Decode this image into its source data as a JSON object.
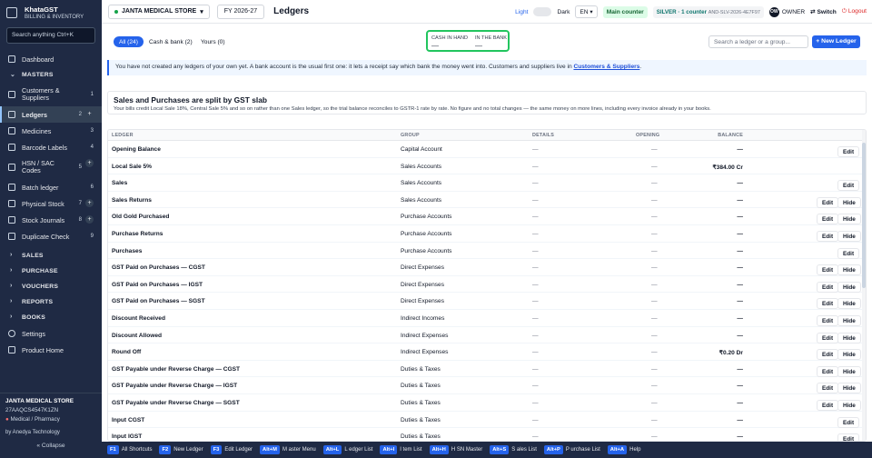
{
  "app": {
    "name": "KhataGST",
    "tagline": "BILLING & INVENTORY"
  },
  "sidebar": {
    "search_placeholder": "Search anything  Ctrl+K",
    "items": [
      {
        "id": "dashboard",
        "label": "Dashboard",
        "icon": "dashboard-icon"
      },
      {
        "id": "customers-suppliers",
        "label": "Customers & Suppliers",
        "count": "1",
        "icon": "users-icon"
      },
      {
        "id": "ledgers",
        "label": "Ledgers",
        "count": "2",
        "icon": "book-icon",
        "active": true
      },
      {
        "id": "medicines",
        "label": "Medicines",
        "count": "3",
        "icon": "pill-icon"
      },
      {
        "id": "barcode-labels",
        "label": "Barcode Labels",
        "count": "4",
        "icon": "barcode-icon"
      },
      {
        "id": "hsn-sac",
        "label": "HSN / SAC Codes",
        "count": "5",
        "icon": "tag-icon"
      },
      {
        "id": "batch-ledger",
        "label": "Batch ledger",
        "count": "6",
        "icon": "batch-icon"
      },
      {
        "id": "physical-stock",
        "label": "Physical Stock",
        "count": "7",
        "icon": "box-icon"
      },
      {
        "id": "stock-journals",
        "label": "Stock Journals",
        "count": "8",
        "icon": "journal-icon"
      },
      {
        "id": "duplicate-check",
        "label": "Duplicate Check",
        "count": "9",
        "icon": "copy-icon"
      }
    ],
    "sections": {
      "masters": "MASTERS",
      "sales": "SALES",
      "purchase": "PURCHASE",
      "vouchers": "VOUCHERS",
      "reports": "REPORTS",
      "books": "BOOKS"
    },
    "settings": "Settings",
    "product_home": "Product Home",
    "company": "JANTA MEDICAL STORE",
    "gstin": "27AAQCS4547K1ZN",
    "business_type": "Medical / Pharmacy",
    "by": "by Anedya Technology",
    "collapse": "« Collapse"
  },
  "topbar": {
    "company": "JANTA MEDICAL STORE",
    "fy": "FY 2026-27",
    "title": "Ledgers",
    "theme_light": "Light",
    "theme_dark": "Dark",
    "lang": "EN",
    "counter": "Main counter",
    "plan": "SILVER · 1 counter",
    "plan_code": "AND-SLV-2026-4E7F97",
    "avatar": "OW",
    "role": "OWNER",
    "switch": "Switch",
    "logout": "Logout"
  },
  "filters": {
    "tabs": [
      {
        "label": "All (24)",
        "active": true
      },
      {
        "label": "Cash & bank (2)",
        "active": false
      },
      {
        "label": "Yours (0)",
        "active": false
      }
    ],
    "cash_label": "CASH IN HAND",
    "cash_value": "—",
    "bank_label": "IN THE BANK",
    "bank_value": "—",
    "search_placeholder": "Search a ledger or a group...",
    "new_ledger": "+ New Ledger"
  },
  "info": {
    "text": "You have not created any ledgers of your own yet. A bank account is the usual first one: it lets a receipt say which bank the money went into. Customers and suppliers live in ",
    "link": "Customers & Suppliers",
    "end": "."
  },
  "gst_card": {
    "title": "Sales and Purchases are split by GST slab",
    "desc": "Your bills credit Local Sale 18%, Central Sale 5% and so on rather than one Sales ledger, so the trial balance reconciles to GSTR-1 rate by rate. No figure and no total changes — the same money on more lines, including every invoice already in your books."
  },
  "table": {
    "headers": {
      "ledger": "LEDGER",
      "group": "GROUP",
      "details": "DETAILS",
      "opening": "OPENING",
      "balance": "BALANCE"
    },
    "rows": [
      {
        "name": "Opening Balance",
        "group": "Capital Account",
        "details": "—",
        "opening": "—",
        "balance": "—",
        "edit": true,
        "hide": false
      },
      {
        "name": "Local Sale 5%",
        "group": "Sales Accounts",
        "details": "—",
        "opening": "—",
        "balance": "₹384.00 Cr",
        "edit": false,
        "hide": false
      },
      {
        "name": "Sales",
        "group": "Sales Accounts",
        "details": "—",
        "opening": "—",
        "balance": "—",
        "edit": true,
        "hide": false
      },
      {
        "name": "Sales Returns",
        "group": "Sales Accounts",
        "details": "—",
        "opening": "—",
        "balance": "—",
        "edit": true,
        "hide": true
      },
      {
        "name": "Old Gold Purchased",
        "group": "Purchase Accounts",
        "details": "—",
        "opening": "—",
        "balance": "—",
        "edit": true,
        "hide": true
      },
      {
        "name": "Purchase Returns",
        "group": "Purchase Accounts",
        "details": "—",
        "opening": "—",
        "balance": "—",
        "edit": true,
        "hide": true
      },
      {
        "name": "Purchases",
        "group": "Purchase Accounts",
        "details": "—",
        "opening": "—",
        "balance": "—",
        "edit": true,
        "hide": false
      },
      {
        "name": "GST Paid on Purchases — CGST",
        "group": "Direct Expenses",
        "details": "—",
        "opening": "—",
        "balance": "—",
        "edit": true,
        "hide": true
      },
      {
        "name": "GST Paid on Purchases — IGST",
        "group": "Direct Expenses",
        "details": "—",
        "opening": "—",
        "balance": "—",
        "edit": true,
        "hide": true
      },
      {
        "name": "GST Paid on Purchases — SGST",
        "group": "Direct Expenses",
        "details": "—",
        "opening": "—",
        "balance": "—",
        "edit": true,
        "hide": true
      },
      {
        "name": "Discount Received",
        "group": "Indirect Incomes",
        "details": "—",
        "opening": "—",
        "balance": "—",
        "edit": true,
        "hide": true
      },
      {
        "name": "Discount Allowed",
        "group": "Indirect Expenses",
        "details": "—",
        "opening": "—",
        "balance": "—",
        "edit": true,
        "hide": true
      },
      {
        "name": "Round Off",
        "group": "Indirect Expenses",
        "details": "—",
        "opening": "—",
        "balance": "₹0.20 Dr",
        "edit": true,
        "hide": true
      },
      {
        "name": "GST Payable under Reverse Charge — CGST",
        "group": "Duties & Taxes",
        "details": "—",
        "opening": "—",
        "balance": "—",
        "edit": true,
        "hide": true
      },
      {
        "name": "GST Payable under Reverse Charge — IGST",
        "group": "Duties & Taxes",
        "details": "—",
        "opening": "—",
        "balance": "—",
        "edit": true,
        "hide": true
      },
      {
        "name": "GST Payable under Reverse Charge — SGST",
        "group": "Duties & Taxes",
        "details": "—",
        "opening": "—",
        "balance": "—",
        "edit": true,
        "hide": true
      },
      {
        "name": "Input CGST",
        "group": "Duties & Taxes",
        "details": "—",
        "opening": "—",
        "balance": "—",
        "edit": true,
        "hide": false
      },
      {
        "name": "Input IGST",
        "group": "Duties & Taxes",
        "details": "—",
        "opening": "—",
        "balance": "—",
        "edit": true,
        "hide": false
      }
    ],
    "edit_label": "Edit",
    "hide_label": "Hide"
  },
  "shortcuts": [
    {
      "key": "F1",
      "label": "All Shortcuts"
    },
    {
      "key": "F2",
      "label": "New Ledger"
    },
    {
      "key": "F3",
      "label": "Edit Ledger"
    },
    {
      "key": "Alt+M",
      "label": "M aster Menu"
    },
    {
      "key": "Alt+L",
      "label": "L edger List"
    },
    {
      "key": "Alt+I",
      "label": "I tem List"
    },
    {
      "key": "Alt+H",
      "label": "H SN Master"
    },
    {
      "key": "Alt+S",
      "label": "S ales List"
    },
    {
      "key": "Alt+P",
      "label": "P urchase List"
    },
    {
      "key": "Alt+A",
      "label": "Help"
    }
  ],
  "colors": {
    "primary": "#2563eb",
    "sidebar": "#1f2a44",
    "highlight_border": "#22c55e",
    "danger": "#dc2626"
  }
}
